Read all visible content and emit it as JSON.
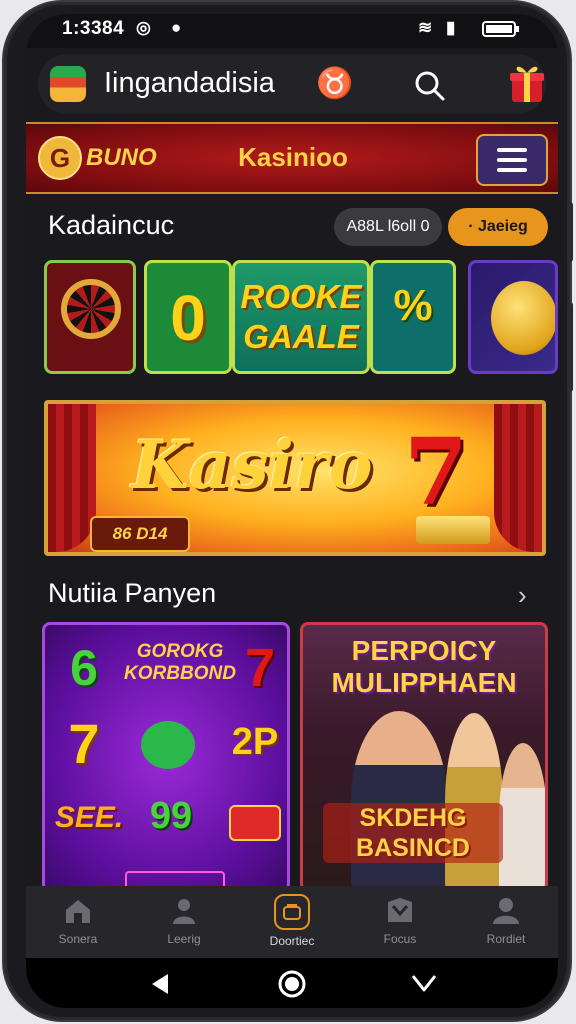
{
  "status_bar": {
    "time": "1:3384",
    "icons": [
      "whatsapp-icon",
      "notification-icon",
      "wifi-icon",
      "signal-icon",
      "battery-icon"
    ]
  },
  "app_bar": {
    "title": "Iingandadisia",
    "icons": [
      "app-logo-icon",
      "search-icon",
      "gift-icon"
    ]
  },
  "casino_header": {
    "brand_text": "BUNO",
    "brand_letter": "G",
    "title": "Kasinioo",
    "menu_icon": "hamburger-menu-icon"
  },
  "section1": {
    "title": "Kadaincuc",
    "filter_pill": "A88L l6oll 0",
    "action_pill": "· Jaeieg"
  },
  "thumbnails": {
    "zero_text": "0",
    "rooke_text": "ROOKE GAALE",
    "percent_text": "%"
  },
  "banner": {
    "title": "Kasiro",
    "seven": "7",
    "tag": "86 D14"
  },
  "section2": {
    "title": "Nutiia Panyen",
    "chevron_icon": "chevron-right-icon"
  },
  "card_left": {
    "heading": "GOROKG KORBBOND",
    "symbols": [
      "6",
      "7",
      "7",
      "2P",
      "SEE.",
      "99"
    ]
  },
  "card_right": {
    "heading": "PERPOICY MULIPPHAEN",
    "subheading": "SKDEHG BASINCD"
  },
  "bottom_nav": {
    "items": [
      {
        "label": "Sonera",
        "icon": "home-icon"
      },
      {
        "label": "Leerig",
        "icon": "person-icon"
      },
      {
        "label": "Doortiec",
        "icon": "wallet-icon"
      },
      {
        "label": "Focus",
        "icon": "gift-box-icon"
      },
      {
        "label": "Rordiet",
        "icon": "profile-icon"
      }
    ],
    "active_index": 2
  },
  "system_nav": {
    "icons": [
      "back-icon",
      "home-circle-icon",
      "recents-icon"
    ]
  },
  "colors": {
    "accent": "#e8951e",
    "header_red": "#b31a1a",
    "gold": "#ffd24a"
  }
}
